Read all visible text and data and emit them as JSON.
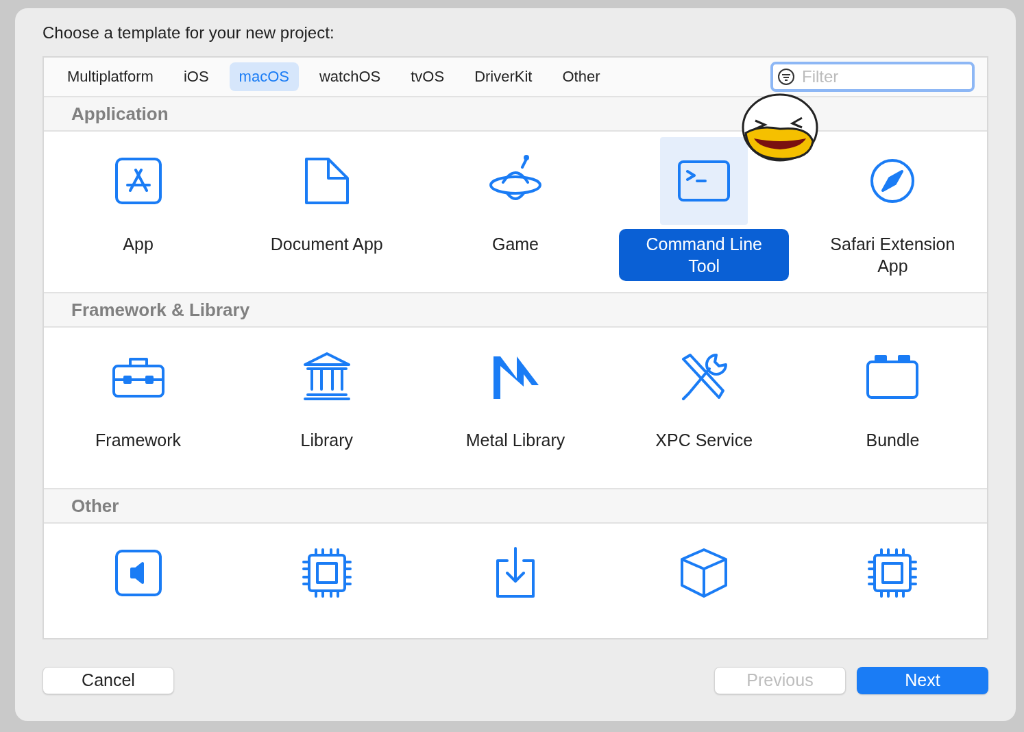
{
  "title": "Choose a template for your new project:",
  "tabs": [
    {
      "label": "Multiplatform",
      "selected": false
    },
    {
      "label": "iOS",
      "selected": false
    },
    {
      "label": "macOS",
      "selected": true
    },
    {
      "label": "watchOS",
      "selected": false
    },
    {
      "label": "tvOS",
      "selected": false
    },
    {
      "label": "DriverKit",
      "selected": false
    },
    {
      "label": "Other",
      "selected": false
    }
  ],
  "filter": {
    "placeholder": "Filter"
  },
  "sections": [
    {
      "title": "Application",
      "items": [
        {
          "kind": "app",
          "label": "App",
          "selected": false
        },
        {
          "kind": "document",
          "label": "Document App",
          "selected": false
        },
        {
          "kind": "game",
          "label": "Game",
          "selected": false
        },
        {
          "kind": "terminal",
          "label": "Command Line Tool",
          "selected": true,
          "sticker": true
        },
        {
          "kind": "compass",
          "label": "Safari Extension App",
          "selected": false
        }
      ]
    },
    {
      "title": "Framework & Library",
      "items": [
        {
          "kind": "toolbox",
          "label": "Framework",
          "selected": false
        },
        {
          "kind": "library",
          "label": "Library",
          "selected": false
        },
        {
          "kind": "metal",
          "label": "Metal Library",
          "selected": false
        },
        {
          "kind": "tools",
          "label": "XPC Service",
          "selected": false
        },
        {
          "kind": "bundle",
          "label": "Bundle",
          "selected": false
        }
      ]
    },
    {
      "title": "Other",
      "items": [
        {
          "kind": "speaker",
          "selected": false
        },
        {
          "kind": "chip",
          "selected": false
        },
        {
          "kind": "download",
          "selected": false
        },
        {
          "kind": "box",
          "selected": false
        },
        {
          "kind": "chip",
          "selected": false
        }
      ]
    }
  ],
  "buttons": [
    {
      "label": "Cancel",
      "kind": "normal",
      "disabled": false
    },
    {
      "label": "Previous",
      "kind": "normal",
      "disabled": true
    },
    {
      "label": "Next",
      "kind": "primary",
      "disabled": false
    }
  ]
}
